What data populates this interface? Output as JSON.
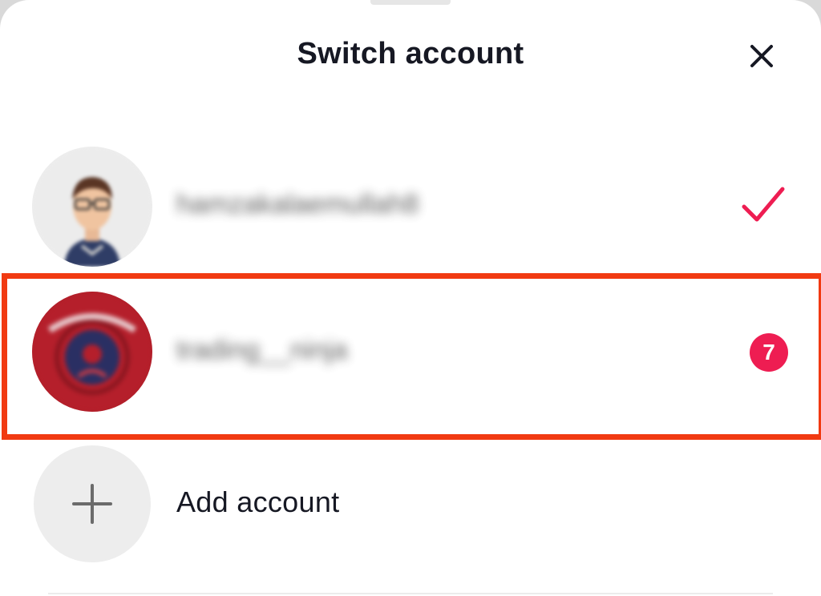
{
  "header": {
    "title": "Switch account",
    "close_icon": "close-icon"
  },
  "accounts": [
    {
      "username": "hamzakalaemullah8",
      "avatar_icon": "profile-avatar-cartoon",
      "status_icon": "checkmark-icon",
      "selected": true,
      "accent_color": "#ee1d52"
    },
    {
      "username": "trading__ninja",
      "avatar_icon": "profile-avatar-red-logo",
      "notification_count": "7",
      "selected": false,
      "badge_color": "#ee1d52"
    }
  ],
  "add_account": {
    "label": "Add account",
    "icon": "plus-icon"
  },
  "highlight": {
    "target": "trading__ninja",
    "color": "#f13a12"
  }
}
